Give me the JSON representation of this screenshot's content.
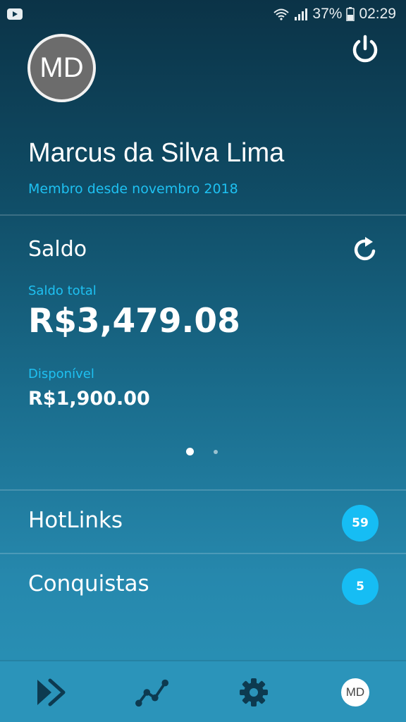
{
  "status_bar": {
    "battery": "37%",
    "time": "02:29",
    "icons": [
      "youtube-icon",
      "wifi-icon",
      "signal-icon",
      "battery-icon"
    ]
  },
  "profile": {
    "initials": "MD",
    "name": "Marcus da Silva Lima",
    "member_since": "Membro desde novembro 2018"
  },
  "balance": {
    "title": "Saldo",
    "total_label": "Saldo total",
    "total_value": "R$3,479.08",
    "available_label": "Disponível",
    "available_value": "R$1,900.00",
    "pages": 2,
    "current_page": 1
  },
  "list": [
    {
      "label": "HotLinks",
      "badge": "59"
    },
    {
      "label": "Conquistas",
      "badge": "5"
    }
  ],
  "bottom_nav": {
    "items": [
      "forward-icon",
      "chart-line-icon",
      "gear-icon",
      "profile-avatar"
    ],
    "avatar_initials": "MD"
  },
  "colors": {
    "accent": "#1ec1f2",
    "badge": "#16bdf4",
    "nav_icon": "#0d3a50"
  }
}
